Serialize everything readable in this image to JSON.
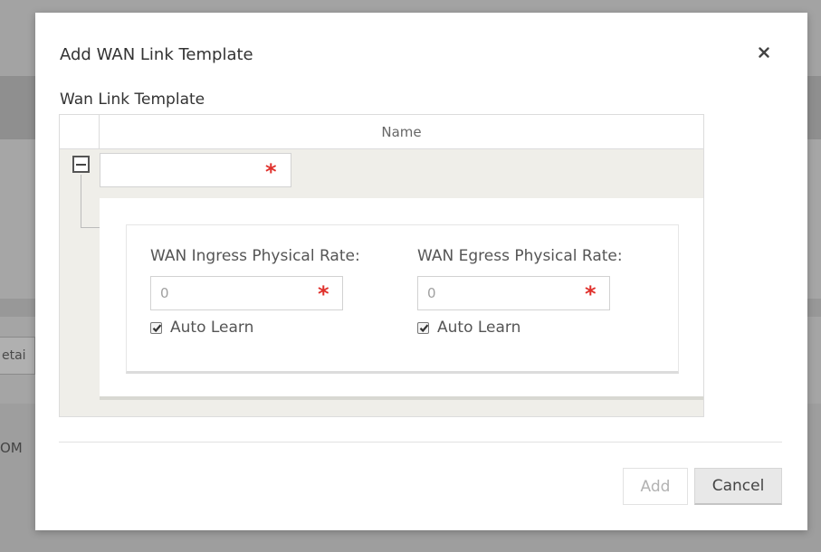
{
  "background": {
    "fragment_text": "etai",
    "fragment_text_2": "OM"
  },
  "modal": {
    "title": "Add WAN Link Template",
    "close_icon": "close-icon",
    "section_label": "Wan Link Template",
    "grid": {
      "columns": [
        "Name"
      ],
      "rows": [
        {
          "name_value": "",
          "expanded": true,
          "ingress": {
            "label": "WAN Ingress Physical Rate:",
            "placeholder": "0",
            "auto_learn_label": "Auto Learn",
            "auto_learn_checked": true
          },
          "egress": {
            "label": "WAN Egress Physical Rate:",
            "placeholder": "0",
            "auto_learn_label": "Auto Learn",
            "auto_learn_checked": true
          }
        }
      ]
    },
    "footer": {
      "add_label": "Add",
      "cancel_label": "Cancel"
    }
  },
  "colors": {
    "required": "#e0312c",
    "overlay": "#9a9a9a"
  }
}
